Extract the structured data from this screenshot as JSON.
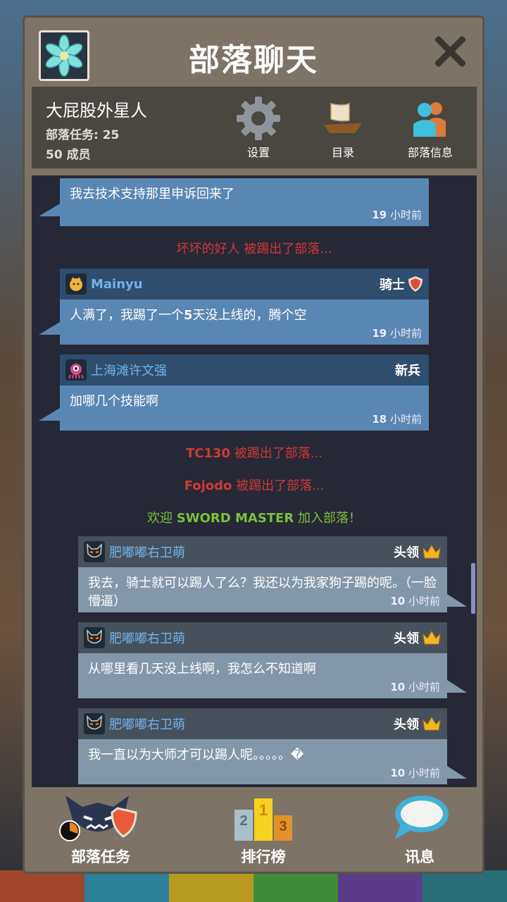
{
  "window": {
    "title": "部落聊天"
  },
  "clan": {
    "name": "大屁股外星人",
    "tasks": "部落任务: 25",
    "members": "50 成员"
  },
  "toolbar": {
    "settings": "设置",
    "directory": "目录",
    "clan_info": "部落信息"
  },
  "messages": [
    {
      "text": "我去技术支持那里申诉回来了",
      "time_num": "19",
      "time_unit": " 小时前"
    },
    {
      "name": "Mainyu",
      "rank": "骑士",
      "text_pre": "人满了，我踢了一个",
      "text_bold": "5",
      "text_post": "天没上线的，腾个空",
      "time_num": "19",
      "time_unit": " 小时前"
    },
    {
      "name": "上海滩许文强",
      "rank": "新兵",
      "text": "加哪几个技能啊",
      "time_num": "18",
      "time_unit": " 小时前"
    },
    {
      "name": "肥嘟嘟右卫萌",
      "rank": "头领",
      "text": "我去，骑士就可以踢人了么？我还以为我家狗子踢的呢。（一脸懵逼）",
      "time_num": "10",
      "time_unit": " 小时前"
    },
    {
      "name": "肥嘟嘟右卫萌",
      "rank": "头领",
      "text": "从哪里看几天没上线啊，我怎么不知道啊",
      "time_num": "10",
      "time_unit": " 小时前"
    },
    {
      "name": "肥嘟嘟右卫萌",
      "rank": "头领",
      "text": "我一直以为大师才可以踢人呢。。。。。�",
      "time_num": "10",
      "time_unit": " 小时前"
    }
  ],
  "system": [
    {
      "who": "坏坏的好人",
      "what": " 被踢出了部落..."
    },
    {
      "who": "TC130",
      "what": " 被踢出了部落..."
    },
    {
      "who": "Fojodo",
      "what": " 被踢出了部落..."
    },
    {
      "pre": "欢迎 ",
      "who": "SWORD MASTER",
      "what": " 加入部落！"
    }
  ],
  "footer": {
    "quests": "部落任务",
    "leaderboard": "排行榜",
    "messages": "讯息"
  },
  "colors": {
    "kick": "#d0393a",
    "welcome": "#7fbf3a",
    "name": "#6fb5ea",
    "panel": "#7d7367"
  }
}
